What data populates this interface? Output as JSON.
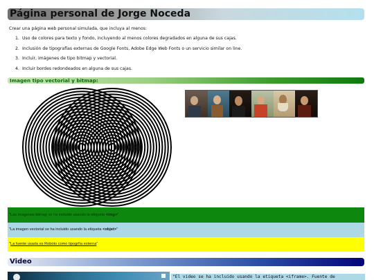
{
  "header": {
    "title": "Página personal de Jorge Noceda"
  },
  "intro": "Crear una página web personal simulada, que incluya al menos:",
  "requirements": [
    {
      "num": "1.",
      "text": "Uso de colores para texto y fondo, incluyendo al menos colores degradados en alguna de sus cajas."
    },
    {
      "num": "2.",
      "text": "Inclusión de tipografías externas de Google Fonts, Adobe Edge Web Fonts o un servicio similar on line."
    },
    {
      "num": "3.",
      "text": "Incluir, imágenes de tipo bitmap y vectorial."
    },
    {
      "num": "4.",
      "text": "Incluir bordes redondeados en alguna de sus cajas."
    }
  ],
  "images_section": {
    "heading": "Imagen tipo vectorial y bitmap:",
    "vector_icon": "concentric-circles-image",
    "bitmap_icon": "portrait-strip-image"
  },
  "notes": {
    "bitmap": {
      "prefix": "\"Las imagenes bitmap se ha incluido usando la etiqueta ",
      "tag": "<img>",
      "suffix": "\""
    },
    "vector": {
      "prefix": "\"La imagen vectorial se ha incluido usando la etiqueta ",
      "tag": "<objet>",
      "suffix": "\""
    },
    "font": {
      "prefix": "\"",
      "link": "La fuente usada es Roboto como tipogrfía externa",
      "suffix": "\""
    }
  },
  "video_section": {
    "heading": "Video",
    "note": "\"El video se ha incluido usando la etiqueta <iframe>. Fuente de"
  },
  "colors": {
    "note_green": "#0e870e",
    "note_blue": "#add8e6",
    "note_yellow": "#ffff00"
  }
}
